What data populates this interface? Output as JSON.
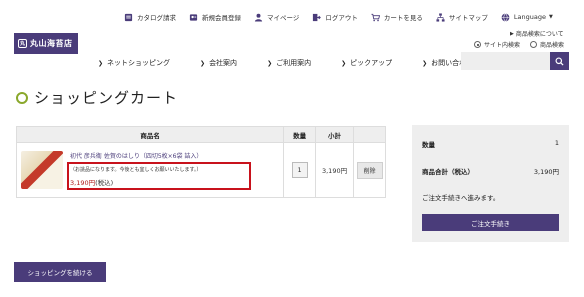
{
  "brand": {
    "logo_text": "丸山海苔店",
    "logo_mark": "丸",
    "accent": "#4a3c7a",
    "highlight": "#c8121c",
    "title_ring": "#8aa82c"
  },
  "utility_nav": [
    {
      "label": "カタログ請求",
      "icon": "catalog-icon"
    },
    {
      "label": "新規会員登録",
      "icon": "register-icon"
    },
    {
      "label": "マイページ",
      "icon": "user-icon"
    },
    {
      "label": "ログアウト",
      "icon": "logout-icon"
    },
    {
      "label": "カートを見る",
      "icon": "cart-icon"
    },
    {
      "label": "サイトマップ",
      "icon": "sitemap-icon"
    },
    {
      "label": "Language",
      "icon": "globe-icon"
    }
  ],
  "search": {
    "about_label": "商品検索について",
    "option_site": "サイト内検索",
    "option_product": "商品検索",
    "selected": "サイト内検索",
    "placeholder": ""
  },
  "main_nav": [
    "ネットショッピング",
    "会社案内",
    "ご利用案内",
    "ピックアップ",
    "お問い合わせ"
  ],
  "page_title": "ショッピングカート",
  "cart": {
    "headers": {
      "product": "商品名",
      "qty": "数量",
      "subtotal": "小計"
    },
    "item": {
      "name": "初代 彦兵衛 佐賀のはしり（四切5枚×6袋 詰入）",
      "note": "（お誂品になります。今後とも宜しくお願いいたします。）",
      "price": "3,190円",
      "tax": "(税込)",
      "qty": "1",
      "subtotal": "3,190円",
      "delete_label": "削除"
    }
  },
  "summary": {
    "qty_label": "数量",
    "qty_value": "1",
    "total_label": "商品合計（税込）",
    "total_value": "3,190円",
    "note": "ご注文手続きへ進みます。",
    "order_button": "ご注文手続き"
  },
  "continue_button": "ショッピングを続ける"
}
